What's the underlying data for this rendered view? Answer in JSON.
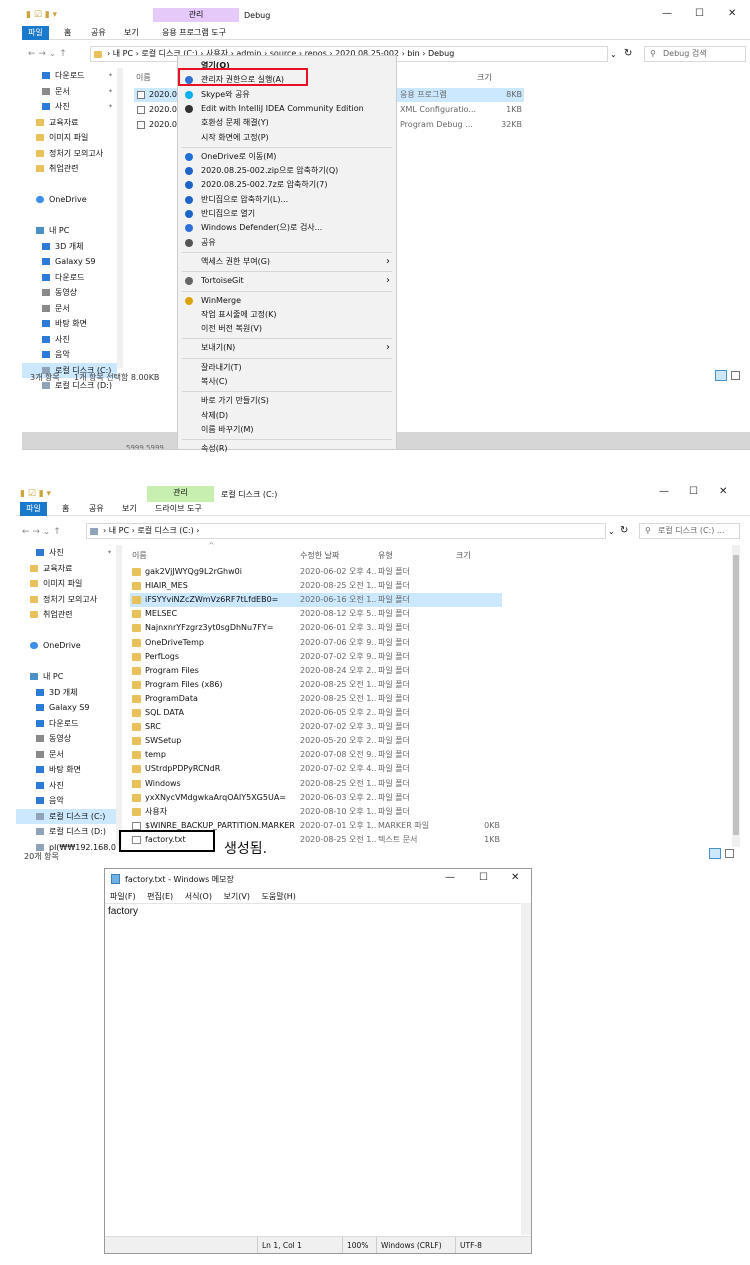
{
  "top": {
    "title": "Debug",
    "manage_label": "관리",
    "tabs": [
      "파일",
      "홈",
      "공유",
      "보기",
      "응용 프로그램 도구"
    ],
    "address": "› 내 PC  ›  로컬 디스크 (C:)  ›  사용자  ›  admin  ›  source  ›  repos  ›  2020.08.25-002  ›  bin  ›  Debug",
    "search_placeholder": "Debug 검색",
    "nav": [
      {
        "label": "다운로드",
        "icon": "download-icon",
        "pin": "✦"
      },
      {
        "label": "문서",
        "icon": "document-icon",
        "pin": "✦"
      },
      {
        "label": "사진",
        "icon": "picture-icon",
        "pin": "✦"
      },
      {
        "label": "교육자료",
        "icon": "folder-icon"
      },
      {
        "label": "이미지 파일",
        "icon": "folder-icon"
      },
      {
        "label": "정처기 모의고사",
        "icon": "folder-icon"
      },
      {
        "label": "취업관련",
        "icon": "folder-icon"
      },
      {
        "label": "",
        "icon": ""
      },
      {
        "label": "OneDrive",
        "icon": "cloud-icon"
      },
      {
        "label": "",
        "icon": ""
      },
      {
        "label": "내 PC",
        "icon": "pc-icon"
      },
      {
        "label": "3D 개체",
        "icon": "3d-objects-icon"
      },
      {
        "label": "Galaxy S9",
        "icon": "phone-icon"
      },
      {
        "label": "다운로드",
        "icon": "download-icon"
      },
      {
        "label": "동영상",
        "icon": "video-icon"
      },
      {
        "label": "문서",
        "icon": "document-icon"
      },
      {
        "label": "바탕 화면",
        "icon": "desktop-icon"
      },
      {
        "label": "사진",
        "icon": "picture-icon"
      },
      {
        "label": "음악",
        "icon": "music-icon"
      },
      {
        "label": "로컬 디스크 (C:)",
        "icon": "drive-icon"
      },
      {
        "label": "로컬 디스크 (D:)",
        "icon": "drive-icon"
      }
    ],
    "columns": {
      "name": "이름",
      "size": "크기"
    },
    "files": [
      {
        "name": "2020.08.",
        "type": "응용 프로그램",
        "size": "8KB",
        "icon": "exe-icon"
      },
      {
        "name": "2020.08.",
        "type": "XML Configuratio...",
        "size": "1KB",
        "icon": "config-icon"
      },
      {
        "name": "2020.08.",
        "type": "Program Debug ...",
        "size": "32KB",
        "icon": "pdb-icon"
      }
    ],
    "status": {
      "count": "3개 항목",
      "selected": "1개 항목 선택함 8.00KB"
    },
    "context_menu": [
      {
        "label": "열기(O)",
        "bold": true
      },
      {
        "label": "관리자 권한으로 실행(A)",
        "icon": "shield-icon"
      },
      {
        "label": "Skype와 공유",
        "icon": "skype-icon"
      },
      {
        "label": "Edit with IntelliJ IDEA Community Edition",
        "icon": "intellij-icon"
      },
      {
        "label": "호환성 문제 해결(Y)"
      },
      {
        "label": "시작 화면에 고정(P)"
      },
      {
        "label": "OneDrive로 이동(M)",
        "icon": "onedrive-icon"
      },
      {
        "label": "2020.08.25-002.zip으로 압축하기(Q)",
        "icon": "bandizip-icon"
      },
      {
        "label": "2020.08.25-002.7z로 압축하기(7)",
        "icon": "bandizip-icon"
      },
      {
        "label": "반디집으로 압축하기(L)...",
        "icon": "bandizip-icon"
      },
      {
        "label": "반디집으로 열기",
        "icon": "bandizip-icon"
      },
      {
        "label": "Windows Defender(으)로 검사...",
        "icon": "defender-icon"
      },
      {
        "label": "공유",
        "icon": "share-icon"
      },
      {
        "label": "액세스 권한 부여(G)",
        "arrow": true
      },
      {
        "label": "TortoiseGit",
        "icon": "tortoisegit-icon",
        "arrow": true
      },
      {
        "label": "WinMerge",
        "icon": "winmerge-icon"
      },
      {
        "label": "작업 표시줄에 고정(K)"
      },
      {
        "label": "이전 버전 복원(V)"
      },
      {
        "label": "보내기(N)",
        "arrow": true
      },
      {
        "label": "잘라내기(T)"
      },
      {
        "label": "복사(C)"
      },
      {
        "label": "바로 가기 만들기(S)"
      },
      {
        "label": "삭제(D)"
      },
      {
        "label": "이름 바꾸기(M)"
      },
      {
        "label": "속성(R)"
      }
    ],
    "bottom_strip": "5999     5999"
  },
  "mid": {
    "title": "로컬 디스크 (C:)",
    "manage_label": "관리",
    "tabs": [
      "파일",
      "홈",
      "공유",
      "보기",
      "드라이브 도구"
    ],
    "address": "› 내 PC  ›  로컬 디스크 (C:)  ›",
    "search_placeholder": "로컬 디스크 (C:) ...",
    "nav": [
      {
        "label": "사진",
        "icon": "picture-icon",
        "pin": "✦"
      },
      {
        "label": "교육자료",
        "icon": "folder-icon"
      },
      {
        "label": "이미지 파일",
        "icon": "folder-icon"
      },
      {
        "label": "정처기 모의고사",
        "icon": "folder-icon"
      },
      {
        "label": "취업관련",
        "icon": "folder-icon"
      },
      {
        "label": "",
        "icon": ""
      },
      {
        "label": "OneDrive",
        "icon": "cloud-icon"
      },
      {
        "label": "",
        "icon": ""
      },
      {
        "label": "내 PC",
        "icon": "pc-icon"
      },
      {
        "label": "3D 개체",
        "icon": "3d-objects-icon"
      },
      {
        "label": "Galaxy S9",
        "icon": "phone-icon"
      },
      {
        "label": "다운로드",
        "icon": "download-icon"
      },
      {
        "label": "동영상",
        "icon": "video-icon"
      },
      {
        "label": "문서",
        "icon": "document-icon"
      },
      {
        "label": "바탕 화면",
        "icon": "desktop-icon"
      },
      {
        "label": "사진",
        "icon": "picture-icon"
      },
      {
        "label": "음악",
        "icon": "music-icon"
      },
      {
        "label": "로컬 디스크 (C:)",
        "icon": "drive-icon"
      },
      {
        "label": "로컬 디스크 (D:)",
        "icon": "drive-icon"
      },
      {
        "label": "pl(₩₩192.168.0.",
        "icon": "network-drive-icon"
      }
    ],
    "columns": {
      "name": "이름",
      "date": "수정한 날짜",
      "type": "유형",
      "size": "크기"
    },
    "files": [
      {
        "name": "gak2VjJWYQg9L2rGhw0i",
        "date": "2020-06-02 오후 4...",
        "type": "파일 폴더",
        "size": ""
      },
      {
        "name": "HIAIR_MES",
        "date": "2020-08-25 오전 1...",
        "type": "파일 폴더",
        "size": ""
      },
      {
        "name": "iFSYYviNZcZWmVz6RF7tLfdEB0=",
        "date": "2020-06-16 오전 1...",
        "type": "파일 폴더",
        "size": ""
      },
      {
        "name": "MELSEC",
        "date": "2020-08-12 오후 5...",
        "type": "파일 폴더",
        "size": ""
      },
      {
        "name": "NajnxnrYFzgrz3yt0sgDhNu7FY=",
        "date": "2020-06-01 오후 3...",
        "type": "파일 폴더",
        "size": ""
      },
      {
        "name": "OneDriveTemp",
        "date": "2020-07-06 오후 9...",
        "type": "파일 폴더",
        "size": ""
      },
      {
        "name": "PerfLogs",
        "date": "2020-07-02 오후 9...",
        "type": "파일 폴더",
        "size": ""
      },
      {
        "name": "Program Files",
        "date": "2020-08-24 오후 2...",
        "type": "파일 폴더",
        "size": ""
      },
      {
        "name": "Program Files (x86)",
        "date": "2020-08-25 오전 1...",
        "type": "파일 폴더",
        "size": ""
      },
      {
        "name": "ProgramData",
        "date": "2020-08-25 오전 1...",
        "type": "파일 폴더",
        "size": ""
      },
      {
        "name": "SQL DATA",
        "date": "2020-06-05 오후 2...",
        "type": "파일 폴더",
        "size": ""
      },
      {
        "name": "SRC",
        "date": "2020-07-02 오후 3...",
        "type": "파일 폴더",
        "size": ""
      },
      {
        "name": "SWSetup",
        "date": "2020-05-20 오후 2...",
        "type": "파일 폴더",
        "size": ""
      },
      {
        "name": "temp",
        "date": "2020-07-08 오전 9...",
        "type": "파일 폴더",
        "size": ""
      },
      {
        "name": "UStrdpPDPyRCNdR",
        "date": "2020-07-02 오후 4...",
        "type": "파일 폴더",
        "size": ""
      },
      {
        "name": "Windows",
        "date": "2020-08-25 오전 1...",
        "type": "파일 폴더",
        "size": ""
      },
      {
        "name": "yxXNycVMdgwkaArqOAIY5XG5UA=",
        "date": "2020-06-03 오후 2...",
        "type": "파일 폴더",
        "size": ""
      },
      {
        "name": "사용자",
        "date": "2020-08-10 오후 1...",
        "type": "파일 폴더",
        "size": ""
      },
      {
        "name": "$WINRE_BACKUP_PARTITION.MARKER",
        "date": "2020-07-01 오후 1...",
        "type": "MARKER 파일",
        "size": "0KB"
      },
      {
        "name": "factory.txt",
        "date": "2020-08-25 오전 1...",
        "type": "텍스트 문서",
        "size": "1KB"
      }
    ],
    "status": "20개 항목",
    "annotation": "생성됨."
  },
  "notepad": {
    "title": "factory.txt - Windows 메모장",
    "menu": [
      "파일(F)",
      "편집(E)",
      "서식(O)",
      "보기(V)",
      "도움말(H)"
    ],
    "content": "factory",
    "status": {
      "pos": "Ln 1, Col 1",
      "zoom": "100%",
      "eol": "Windows (CRLF)",
      "enc": "UTF-8"
    }
  },
  "colors": {
    "accent": "#1979ca",
    "manage_tab_top": "#e5c9f8",
    "manage_tab_mid": "#c6efb0",
    "highlight": "#cce8ff",
    "red_box": "#e81123"
  }
}
